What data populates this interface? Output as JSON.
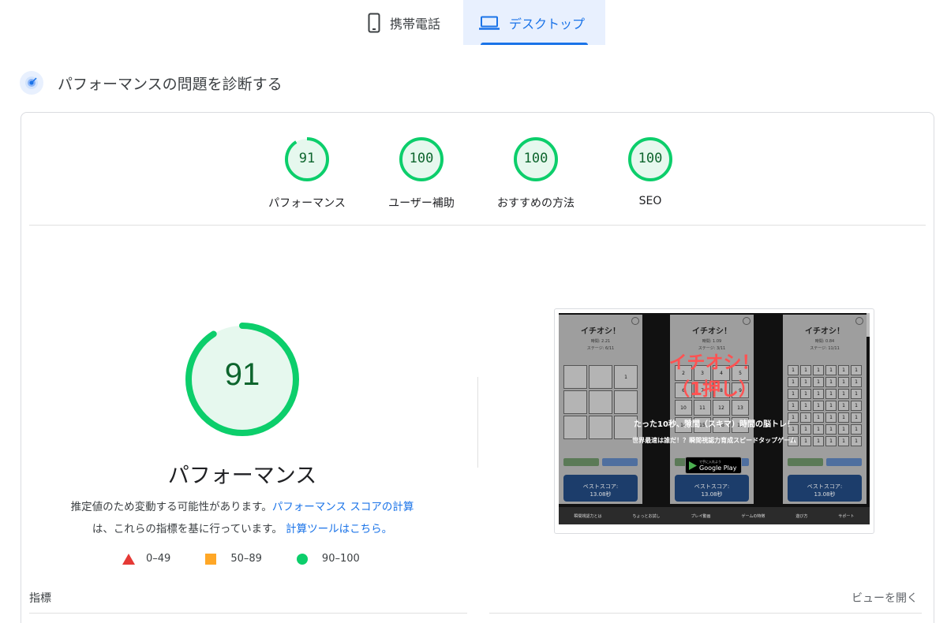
{
  "tabs": {
    "mobile": "携帯電話",
    "desktop": "デスクトップ"
  },
  "diagnose": {
    "title": "パフォーマンスの問題を診断する"
  },
  "gauges": [
    {
      "score": "91",
      "label": "パフォーマンス"
    },
    {
      "score": "100",
      "label": "ユーザー補助"
    },
    {
      "score": "100",
      "label": "おすすめの方法"
    },
    {
      "score": "100",
      "label": "SEO"
    }
  ],
  "main": {
    "score": "91",
    "score_fraction": 0.91,
    "title": "パフォーマンス",
    "desc_text1": "推定値のため変動する可能性があります。",
    "desc_link1": "パフォーマンス スコアの計算",
    "desc_text2": "は、これらの指標を基に行っています。",
    "desc_link2": "計算ツールはこちら。"
  },
  "legend": [
    {
      "range": "0–49"
    },
    {
      "range": "50–89"
    },
    {
      "range": "90–100"
    }
  ],
  "metrics": {
    "label": "指標",
    "view_toggle": "ビューを開く"
  },
  "thumbnail": {
    "phone_title": "イチオシ！",
    "phone1_sub": "時間: 2.21\nステージ: 6/11",
    "phone2_sub": "時間: 1.09\nステージ: 3/11",
    "phone3_sub": "時間: 0.84\nステージ: 11/11",
    "overlay_title_line1": "イチオシ！",
    "overlay_title_line2": "（1押し）",
    "overlay_sub1": "たった10秒、隙間（スキマ）時間の脳トレ！",
    "overlay_sub2": "世界最速は誰だ！？瞬間視認力育成スピードタップゲーム",
    "gplay_label": "Google Play",
    "gplay_small": "で手に入れよう",
    "best_label": "ベストスコア:",
    "best_value": "13.08秒",
    "nav": [
      "瞬間視認力とは",
      "ちょっとお試し",
      "プレイ動画",
      "ゲームの特徴",
      "遊び方",
      "サポート"
    ]
  },
  "colors": {
    "pass": "#0cce6b",
    "pass_text": "#0d652d",
    "average": "#ffa726",
    "fail": "#e53935",
    "accent": "#1a73e8"
  }
}
